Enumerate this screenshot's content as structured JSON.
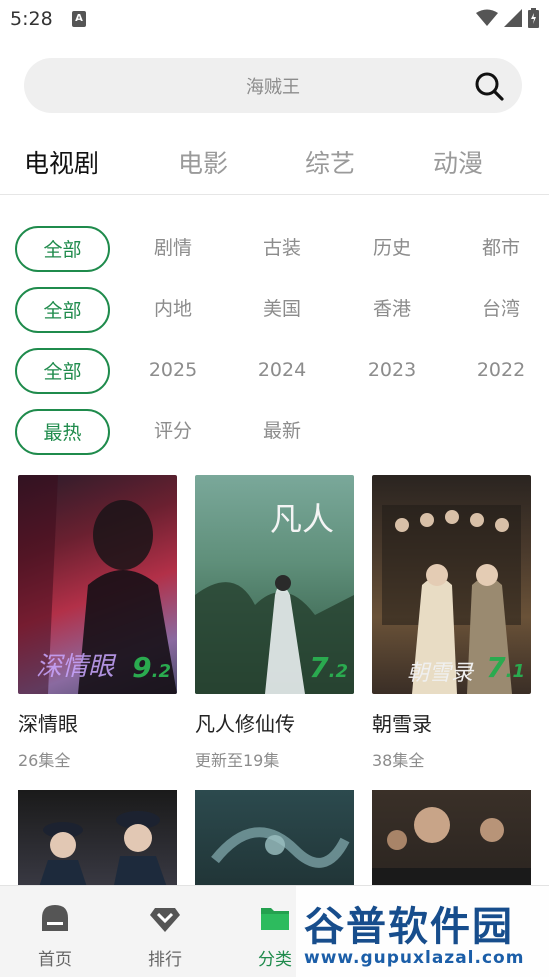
{
  "status": {
    "time": "5:28"
  },
  "search": {
    "placeholder": "海贼王"
  },
  "type_tabs": [
    "电视剧",
    "电影",
    "综艺",
    "动漫"
  ],
  "filters": {
    "genre": [
      "全部",
      "剧情",
      "古装",
      "历史",
      "都市"
    ],
    "region": [
      "全部",
      "内地",
      "美国",
      "香港",
      "台湾"
    ],
    "year": [
      "全部",
      "2025",
      "2024",
      "2023",
      "2022"
    ],
    "sort": [
      "最热",
      "评分",
      "最新"
    ]
  },
  "cards": [
    {
      "title": "深情眼",
      "subtitle": "26集全",
      "score_int": "9",
      "score_dec": ".2"
    },
    {
      "title": "凡人修仙传",
      "subtitle": "更新至19集",
      "score_int": "7",
      "score_dec": ".2"
    },
    {
      "title": "朝雪录",
      "subtitle": "38集全",
      "score_int": "7",
      "score_dec": ".1"
    }
  ],
  "bottom_nav": [
    "首页",
    "排行",
    "分类"
  ],
  "watermark": {
    "name": "谷普软件园",
    "url": "www.gupuxlazal.com"
  },
  "colors": {
    "accent": "#1f8b4c",
    "score": "#2aaa4f"
  }
}
